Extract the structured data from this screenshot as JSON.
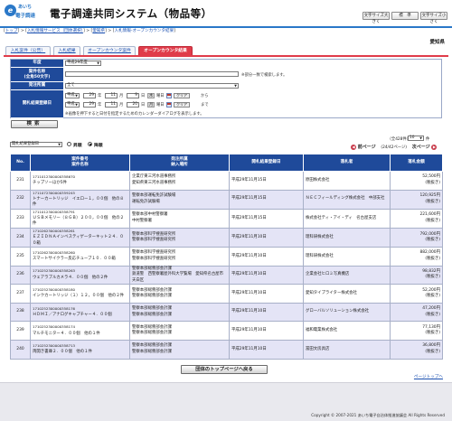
{
  "header": {
    "logo_mark": "e",
    "logo_top": "あいち",
    "logo_bottom": "電子調達",
    "title": "電子調達共同システム（物品等）",
    "font_large": "文字サイズ大きく",
    "font_standard": "標　準",
    "font_small": "文字サイズ小さく"
  },
  "breadcrumb": {
    "items": [
      "トップ",
      "入札情報サービス（団体選択）",
      "愛知県"
    ],
    "current": "入札情報-オープンカウンタ結果"
  },
  "region": "愛知県",
  "tabs": [
    {
      "label": "入札案件（公告）",
      "active": false
    },
    {
      "label": "入札結果",
      "active": false
    },
    {
      "label": "オープンカウンタ案件",
      "active": false
    },
    {
      "label": "オープンカウンタ結果",
      "active": true
    }
  ],
  "form": {
    "year_label": "年度",
    "year_value": "平成29年度",
    "case_label": "案件名称",
    "case_label_sub": "(全角50文字)",
    "case_value": "",
    "case_note": "※部分一致で検索します。",
    "org_label": "発注所属",
    "org_value": "全て",
    "date_label": "開札結果登録日",
    "from": {
      "era": "平成",
      "year": "29",
      "month": "11",
      "day": "9",
      "dow": "木"
    },
    "to": {
      "era": "平成",
      "year": "29",
      "month": "11",
      "day": "20",
      "dow": "月"
    },
    "year_unit": "年",
    "month_unit": "月",
    "day_unit": "日",
    "dow_unit": "曜日",
    "clear_label": "クリア",
    "from_suffix": "から",
    "to_suffix": "まで",
    "calendar_note": "※画像を押下すると日付を指定するためのカレンダーダイアログを表示します。",
    "search_button": "検索"
  },
  "controls": {
    "sort_value": "開札結果登録日",
    "asc_label": "昇順",
    "desc_label": "降順",
    "desc_selected": true,
    "count_text": "（全428件）",
    "per_page": "10",
    "per_unit": "件",
    "prev_label": "前ページ",
    "page_info": "(24/42ページ)",
    "next_label": "次ページ"
  },
  "table": {
    "headers": {
      "no": "No.",
      "case_id": "案件番号",
      "case_name": "案件名称",
      "org_top": "発注所属",
      "org_bottom": "納入場所",
      "date": "開札結果登録日",
      "winner": "落札者",
      "amount": "落札金額"
    },
    "rows": [
      {
        "no": "231",
        "id": "171101230000035867​0",
        "name": "チップソーほか5件",
        "org1": "企業庁東三河水道事務所",
        "org2": "愛知県東三河水道事務所",
        "date": "平成29年11月15日",
        "winner": "原田株式会社",
        "amount": "52,500円",
        "tax": "(税抜き)"
      },
      {
        "no": "232",
        "id": "171107230000035924​5",
        "name": "トナーカートリッジ　イエロー１，００個　他の８件",
        "org1": "警察本部運転免許試験場",
        "org2": "運転免許試験場",
        "date": "平成29年11月15日",
        "winner": "ＮＥＣフィールディング株式会社　中部支社",
        "amount": "120,925円",
        "tax": "(税抜き)"
      },
      {
        "no": "233",
        "id": "171101230000035879​1",
        "name": "ＵＳＢメモリー（８ＧＢ）２００，００個　他の２件",
        "org1": "警察本部中村警察署",
        "org2": "中村警察署",
        "date": "平成29年11月15日",
        "winner": "株式会社ティ・アイ・ディ　名古屋支店",
        "amount": "221,600円",
        "tax": "(税抜き)"
      },
      {
        "no": "234",
        "id": "171026230000035826​1",
        "name": "ＥＺＩＤＮＡインベスティゲーターキット２４．００箱",
        "org1": "警察本部科学捜査研究所",
        "org2": "警察本部科学捜査研究所",
        "date": "平成29年11月10日",
        "winner": "理科研株式会社",
        "amount": "792,000円",
        "tax": "(税抜き)"
      },
      {
        "no": "235",
        "id": "171026230000035826​0",
        "name": "スマートサイクラー反応チューブ１０．００箱",
        "org1": "警察本部科学捜査研究所",
        "org2": "警察本部科学捜査研究所",
        "date": "平成29年11月10日",
        "winner": "理科研株式会社",
        "amount": "882,000円",
        "tax": "(税抜き)"
      },
      {
        "no": "236",
        "id": "171025230000035826​3",
        "name": "ウェアラブルカメラ４．００個　他の２件",
        "org1": "警察本部総務部会計課",
        "org2": "鉄道警　西警察署屋外科大学覧場　愛知県名古屋市天白区",
        "date": "平成29年11月10日",
        "winner": "企業会社ヒロミ写真機店",
        "amount": "98,832円",
        "tax": "(税抜き)"
      },
      {
        "no": "237",
        "id": "171025230000035818​0",
        "name": "インクカートリッジ（１）１２，００個　他の２件",
        "org1": "警察本部総務部会計課",
        "org2": "警察本部総務部会計課",
        "date": "平成29年11月10日",
        "winner": "愛知タイプライター株式会社",
        "amount": "52,200円",
        "tax": "(税抜き)"
      },
      {
        "no": "238",
        "id": "171025230000035817​6",
        "name": "ＨＤＭＩ／アナログキャプチャー４．００個",
        "org1": "警察本部総務部会計課",
        "org2": "警察本部総務部会計課",
        "date": "平成29年11月10日",
        "winner": "グローバルソリューション株式会社",
        "amount": "47,200円",
        "tax": "(税抜き)"
      },
      {
        "no": "239",
        "id": "171025230000035817​4",
        "name": "マルチモニター４．００個　他の１件",
        "org1": "警察本部総務部会計課",
        "org2": "警察本部総務部会計課",
        "date": "平成29年11月10日",
        "winner": "福和電業株式会社",
        "amount": "77,130円",
        "tax": "(税抜き)"
      },
      {
        "no": "240",
        "id": "171025230000035871​3",
        "name": "両開き書庫２．００個　他の１件",
        "org1": "警察本部総務部会計課",
        "org2": "警察本部総務部会計課",
        "date": "平成29年11月10日",
        "winner": "冨田文房具店",
        "amount": "36,800円",
        "tax": "(税抜き)"
      }
    ]
  },
  "back_button": "団体のトップページへ戻る",
  "to_top": "ページトップへ",
  "copyright": "Copyright © 2007-2021 あいち電子自治体推進協議会 All Rights Reserved",
  "colors": {
    "accent_blue": "#1f4a9a",
    "tab_red": "#e03c4a",
    "row_alt": "#e4e4f6"
  }
}
